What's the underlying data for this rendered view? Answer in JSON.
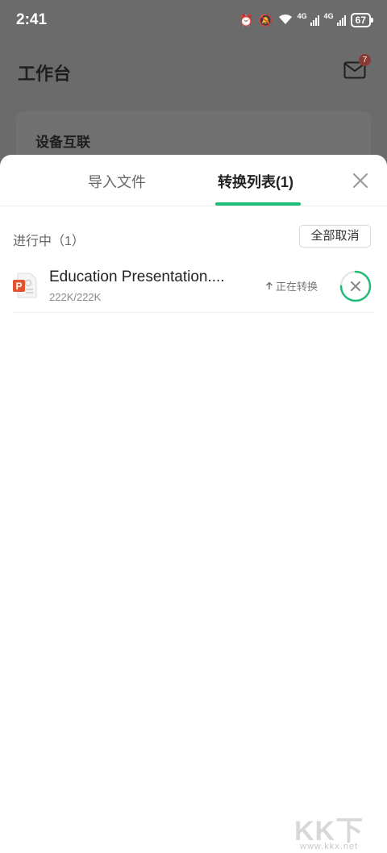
{
  "status_bar": {
    "time": "2:41",
    "network1": "4G",
    "network2": "4G",
    "battery": "67"
  },
  "background": {
    "title": "工作台",
    "mail_badge": "7",
    "card_title": "设备互联"
  },
  "sheet": {
    "tabs": [
      {
        "label": "导入文件",
        "active": false
      },
      {
        "label": "转换列表(1)",
        "active": true
      }
    ],
    "section_title": "进行中（1）",
    "cancel_all_label": "全部取消",
    "files": [
      {
        "name": "Education Presentation....",
        "size": "222K/222K",
        "status": "正在转换",
        "progress": 0.75,
        "icon": "powerpoint-file-icon"
      }
    ]
  },
  "watermark": {
    "text": "KK下载",
    "url": "www.kkx.net"
  },
  "colors": {
    "accent": "#1ebd78",
    "ppt": "#e2542f",
    "overlay": "#6a6b6a"
  }
}
